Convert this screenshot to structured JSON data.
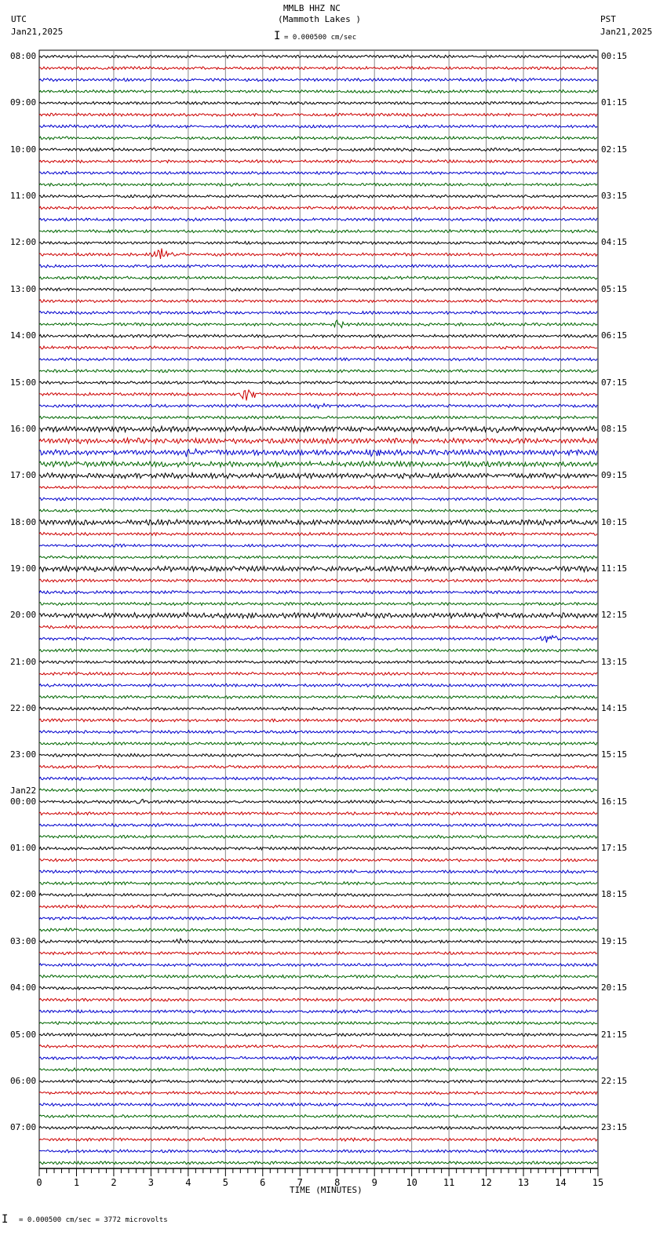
{
  "header": {
    "station": "MMLB HHZ NC",
    "location": "(Mammoth Lakes )",
    "left_tz": "UTC",
    "left_date": "Jan21,2025",
    "right_tz": "PST",
    "right_date": "Jan21,2025",
    "scale_label": "= 0.000500 cm/sec"
  },
  "footer": {
    "scale_label": "= 0.000500 cm/sec =    3772 microvolts"
  },
  "chart_data": {
    "type": "line",
    "title": "MMLB HHZ NC (Mammoth Lakes )",
    "xlabel": "TIME (MINUTES)",
    "xlim": [
      0,
      15
    ],
    "x_ticks": [
      "0",
      "1",
      "2",
      "3",
      "4",
      "5",
      "6",
      "7",
      "8",
      "9",
      "10",
      "11",
      "12",
      "13",
      "14",
      "15"
    ],
    "trace_colors": [
      "#000000",
      "#cc0000",
      "#0000cc",
      "#006600"
    ],
    "trace_count": 96,
    "minutes_per_trace": 15,
    "left_labels": [
      "08:00",
      "09:00",
      "10:00",
      "11:00",
      "12:00",
      "13:00",
      "14:00",
      "15:00",
      "16:00",
      "17:00",
      "18:00",
      "19:00",
      "20:00",
      "21:00",
      "22:00",
      "23:00",
      "00:00",
      "01:00",
      "02:00",
      "03:00",
      "04:00",
      "05:00",
      "06:00",
      "07:00"
    ],
    "date_change_label": "Jan22",
    "right_labels": [
      "00:15",
      "01:15",
      "02:15",
      "03:15",
      "04:15",
      "05:15",
      "06:15",
      "07:15",
      "08:15",
      "09:15",
      "10:15",
      "11:15",
      "12:15",
      "13:15",
      "14:15",
      "15:15",
      "16:15",
      "17:15",
      "18:15",
      "19:15",
      "20:15",
      "21:15",
      "22:15",
      "23:15"
    ],
    "events": [
      {
        "trace": 17,
        "minute": 3.3,
        "amplitude": 4.5
      },
      {
        "trace": 23,
        "minute": 8.0,
        "amplitude": 3.0
      },
      {
        "trace": 29,
        "minute": 5.6,
        "amplitude": 5.0
      },
      {
        "trace": 30,
        "minute": 7.5,
        "amplitude": 2.0
      },
      {
        "trace": 32,
        "minute": 12.2,
        "amplitude": 2.5
      },
      {
        "trace": 34,
        "minute": 9.0,
        "amplitude": 2.5
      },
      {
        "trace": 34,
        "minute": 4.0,
        "amplitude": 2.0
      },
      {
        "trace": 50,
        "minute": 13.7,
        "amplitude": 3.5
      },
      {
        "trace": 64,
        "minute": 2.8,
        "amplitude": 2.0
      },
      {
        "trace": 76,
        "minute": 3.8,
        "amplitude": 2.0
      }
    ],
    "noisy_traces": [
      32,
      33,
      34,
      35,
      36,
      40,
      44,
      48
    ]
  }
}
